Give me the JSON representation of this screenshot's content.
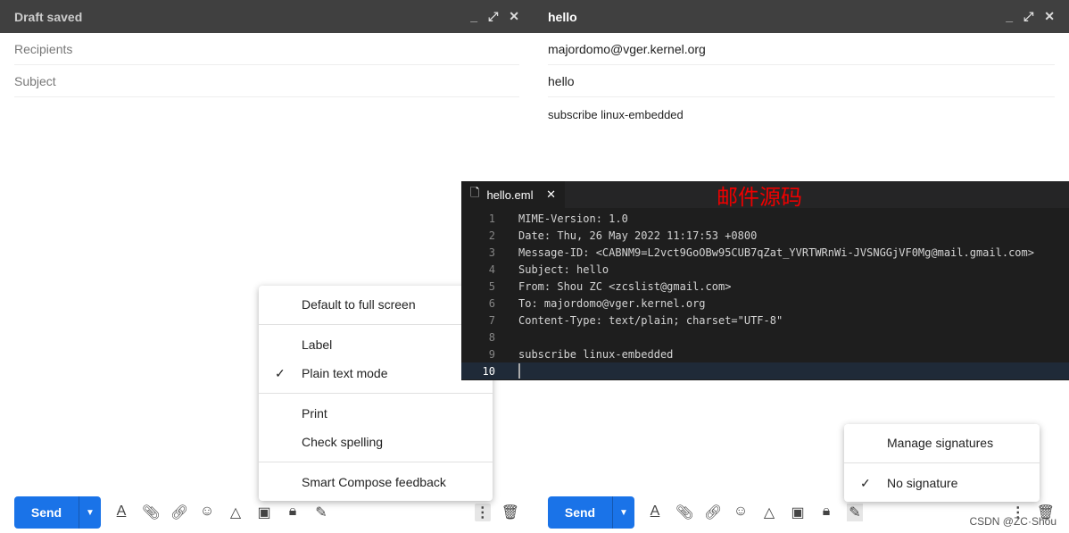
{
  "left": {
    "title": "Draft saved",
    "recipients_placeholder": "Recipients",
    "subject_placeholder": "Subject",
    "send_label": "Send"
  },
  "right": {
    "title": "hello",
    "to": "majordomo@vger.kernel.org",
    "subject": "hello",
    "body": "subscribe linux-embedded",
    "send_label": "Send"
  },
  "more_menu": {
    "items": [
      "Default to full screen",
      "Label",
      "Plain text mode",
      "Print",
      "Check spelling",
      "Smart Compose feedback"
    ],
    "checked": "Plain text mode"
  },
  "signature_menu": {
    "items": [
      "Manage signatures",
      "No signature"
    ],
    "checked": "No signature"
  },
  "editor": {
    "tab": "hello.eml",
    "annotation": "邮件源码",
    "lines": [
      "MIME-Version: 1.0",
      "Date: Thu, 26 May 2022 11:17:53 +0800",
      "Message-ID: <CABNM9=L2vct9GoOBw95CUB7qZat_YVRTWRnWi-JVSNGGjVF0Mg@mail.gmail.com>",
      "Subject: hello",
      "From: Shou ZC <zcslist@gmail.com>",
      "To: majordomo@vger.kernel.org",
      "Content-Type: text/plain; charset=\"UTF-8\"",
      "",
      "subscribe linux-embedded",
      ""
    ],
    "line_numbers": [
      "1",
      "2",
      "3",
      "4",
      "5",
      "6",
      "7",
      "8",
      "9",
      "10"
    ]
  },
  "watermark": "CSDN @ZC·Shou",
  "colors": {
    "header": "#404040",
    "send": "#1a73e8",
    "editor_bg": "#1e1e1e",
    "annotation": "#ee0000"
  }
}
